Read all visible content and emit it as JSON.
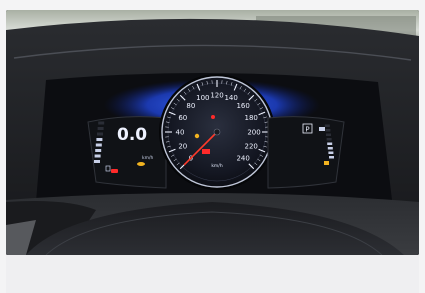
{
  "speedometer": {
    "unit": "km/h",
    "scale": [
      0,
      20,
      40,
      60,
      80,
      100,
      120,
      140,
      160,
      180,
      200,
      220,
      240
    ],
    "scale_min": 0,
    "scale_max": 240,
    "needle_value": 0
  },
  "left_display": {
    "digital_speed": "0.0",
    "sub_label": "km/h",
    "fuel_level_fraction": 0.6
  },
  "right_display": {
    "gear_indicator": "P"
  },
  "colors": {
    "backlight_blue": "#2a5cff",
    "needle_red": "#ff3a2a",
    "warning_red": "#ff2a2a",
    "warning_amber": "#f2b320",
    "gauge_white": "#eef2ff"
  },
  "icons": [
    "engine-warning-icon",
    "battery-warning-icon",
    "oil-warning-icon",
    "seatbelt-icon",
    "fuel-icon",
    "gear-indicator-icon"
  ]
}
